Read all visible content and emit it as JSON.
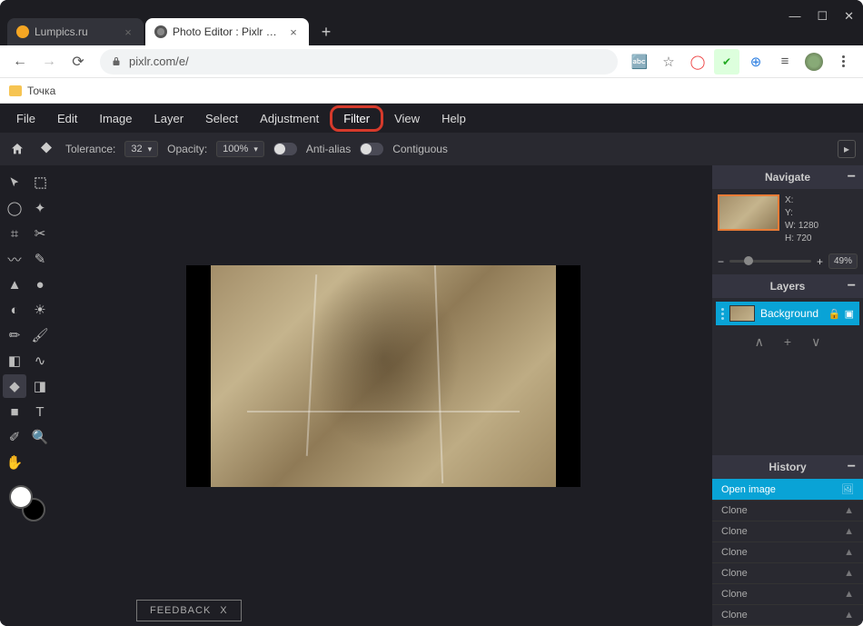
{
  "browser": {
    "tabs": [
      {
        "title": "Lumpics.ru",
        "favicon_color": "#f5a623"
      },
      {
        "title": "Photo Editor : Pixlr E - free image...",
        "favicon_color": "#777"
      }
    ],
    "url_display": "pixlr.com/e/",
    "bookmark_folder": "Точка"
  },
  "menu": {
    "file": "File",
    "edit": "Edit",
    "image": "Image",
    "layer": "Layer",
    "select": "Select",
    "adjustment": "Adjustment",
    "filter": "Filter",
    "view": "View",
    "help": "Help"
  },
  "options": {
    "tolerance_label": "Tolerance:",
    "tolerance_value": "32",
    "opacity_label": "Opacity:",
    "opacity_value": "100%",
    "anti_alias_label": "Anti-alias",
    "contiguous_label": "Contiguous"
  },
  "navigate_panel": {
    "title": "Navigate",
    "x_label": "X:",
    "x_value": "",
    "y_label": "Y:",
    "y_value": "",
    "w_label": "W:",
    "w_value": "1280",
    "h_label": "H:",
    "h_value": "720",
    "zoom_percent": "49%"
  },
  "layers_panel": {
    "title": "Layers",
    "active_layer_name": "Background"
  },
  "history_panel": {
    "title": "History",
    "items": [
      {
        "label": "Open image",
        "active": true,
        "icon": "image"
      },
      {
        "label": "Clone",
        "active": false,
        "icon": "stamp"
      },
      {
        "label": "Clone",
        "active": false,
        "icon": "stamp"
      },
      {
        "label": "Clone",
        "active": false,
        "icon": "stamp"
      },
      {
        "label": "Clone",
        "active": false,
        "icon": "stamp"
      },
      {
        "label": "Clone",
        "active": false,
        "icon": "stamp"
      },
      {
        "label": "Clone",
        "active": false,
        "icon": "stamp"
      }
    ]
  },
  "feedback": {
    "label": "FEEDBACK",
    "close": "X"
  }
}
